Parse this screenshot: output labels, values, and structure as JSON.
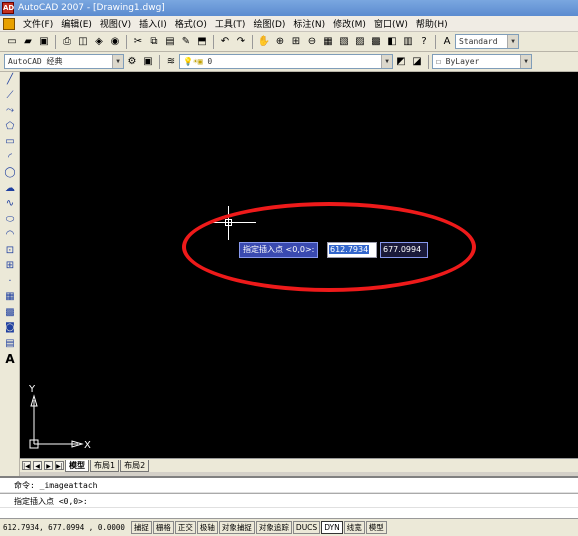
{
  "window": {
    "title": "AutoCAD 2007 - [Drawing1.dwg]",
    "app_icon": "AD"
  },
  "menu": [
    "文件(F)",
    "编辑(E)",
    "视图(V)",
    "插入(I)",
    "格式(O)",
    "工具(T)",
    "绘图(D)",
    "标注(N)",
    "修改(M)",
    "窗口(W)",
    "帮助(H)"
  ],
  "toolbar": {
    "text_style": "Standard",
    "workspace": "AutoCAD 经典",
    "layer": "0",
    "linetype": "ByLayer"
  },
  "dynamic_input": {
    "prompt": "指定插入点 <0,0>:",
    "x_value": "612.7934",
    "y_value": "677.0994"
  },
  "ucs": {
    "x_label": "X",
    "y_label": "Y"
  },
  "layout_tabs": [
    "模型",
    "布局1",
    "布局2"
  ],
  "command_window": {
    "history_label": "命令:",
    "history_value": "_imageattach",
    "current_prompt": "指定插入点 <0,0>:"
  },
  "status": {
    "coordinates": "612.7934,  677.0994 , 0.0000",
    "buttons": [
      "捕捉",
      "栅格",
      "正交",
      "极轴",
      "对象捕捉",
      "对象追踪",
      "DUCS",
      "DYN",
      "线宽",
      "模型"
    ]
  },
  "colors": {
    "canvas": "#000000",
    "highlight_ring": "#ee1a1a",
    "dyn_prompt_bg": "#3a4ab0"
  }
}
